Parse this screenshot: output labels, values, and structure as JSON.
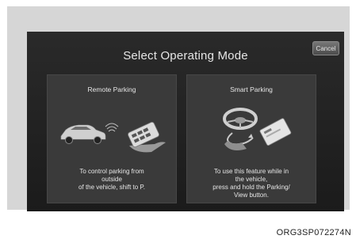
{
  "screen": {
    "title": "Select Operating Mode",
    "cancel_label": "Cancel"
  },
  "modes": [
    {
      "title": "Remote Parking",
      "description": "To control parking from outside\nof the vehicle, shift to P.",
      "icon": "car-with-smart-key-icon"
    },
    {
      "title": "Smart Parking",
      "description": "To use this feature while in the vehicle,\npress and hold the Parking/\nView button.",
      "icon": "steering-wheel-card-key-icon"
    }
  ],
  "caption": "ORG3SP072274N"
}
